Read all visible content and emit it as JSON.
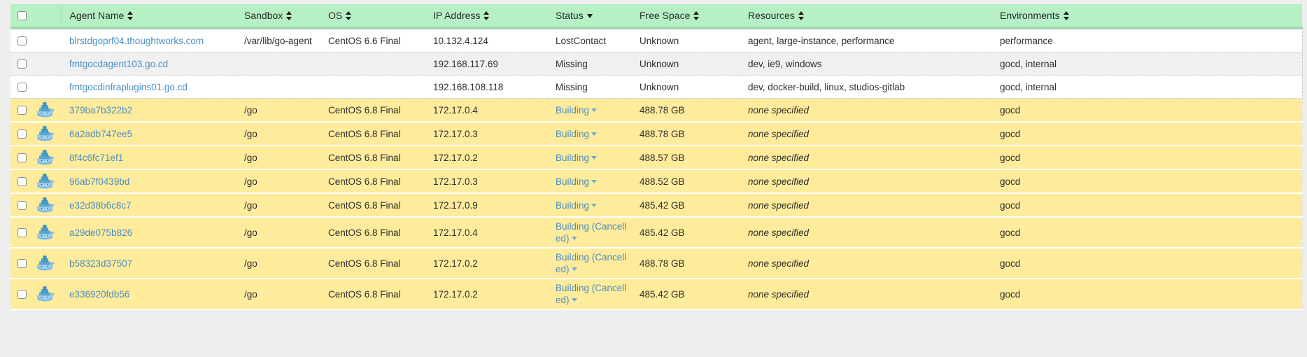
{
  "table": {
    "select_all_checkbox": false,
    "columns": [
      {
        "key": "checkbox",
        "label": "",
        "sort": "none"
      },
      {
        "key": "icon",
        "label": "",
        "sort": "none"
      },
      {
        "key": "agent_name",
        "label": "Agent Name",
        "sort": "both"
      },
      {
        "key": "sandbox",
        "label": "Sandbox",
        "sort": "both"
      },
      {
        "key": "os",
        "label": "OS",
        "sort": "both"
      },
      {
        "key": "ip_address",
        "label": "IP Address",
        "sort": "both"
      },
      {
        "key": "status",
        "label": "Status",
        "sort": "desc"
      },
      {
        "key": "free_space",
        "label": "Free Space",
        "sort": "both"
      },
      {
        "key": "resources",
        "label": "Resources",
        "sort": "both"
      },
      {
        "key": "environments",
        "label": "Environments",
        "sort": "both"
      }
    ],
    "rows": [
      {
        "checked": false,
        "icon": "",
        "agent_name": "blrstdgoprf04.thoughtworks.com",
        "sandbox": "/var/lib/go-agent",
        "os": "CentOS 6.6 Final",
        "ip_address": "10.132.4.124",
        "status": "LostContact",
        "status_link": false,
        "free_space": "Unknown",
        "resources": "agent, large-instance, performance",
        "resources_none": false,
        "environments": "performance",
        "style": "white"
      },
      {
        "checked": false,
        "icon": "",
        "agent_name": "fmtgocdagent103.go.cd",
        "sandbox": "",
        "os": "",
        "ip_address": "192.168.117.69",
        "status": "Missing",
        "status_link": false,
        "free_space": "Unknown",
        "resources": "dev, ie9, windows",
        "resources_none": false,
        "environments": "gocd, internal",
        "style": "grey"
      },
      {
        "checked": false,
        "icon": "",
        "agent_name": "fmtgocdinfraplugins01.go.cd",
        "sandbox": "",
        "os": "",
        "ip_address": "192.168.108.118",
        "status": "Missing",
        "status_link": false,
        "free_space": "Unknown",
        "resources": "dev, docker-build, linux, studios-gitlab",
        "resources_none": false,
        "environments": "gocd, internal",
        "style": "white"
      },
      {
        "checked": false,
        "icon": "docker-icon",
        "agent_name": "379ba7b322b2",
        "sandbox": "/go",
        "os": "CentOS 6.8 Final",
        "ip_address": "172.17.0.4",
        "status": "Building",
        "status_link": true,
        "free_space": "488.78 GB",
        "resources": "none specified",
        "resources_none": true,
        "environments": "gocd",
        "style": "building"
      },
      {
        "checked": false,
        "icon": "docker-icon",
        "agent_name": "6a2adb747ee5",
        "sandbox": "/go",
        "os": "CentOS 6.8 Final",
        "ip_address": "172.17.0.3",
        "status": "Building",
        "status_link": true,
        "free_space": "488.78 GB",
        "resources": "none specified",
        "resources_none": true,
        "environments": "gocd",
        "style": "building"
      },
      {
        "checked": false,
        "icon": "docker-icon",
        "agent_name": "8f4c6fc71ef1",
        "sandbox": "/go",
        "os": "CentOS 6.8 Final",
        "ip_address": "172.17.0.2",
        "status": "Building",
        "status_link": true,
        "free_space": "488.57 GB",
        "resources": "none specified",
        "resources_none": true,
        "environments": "gocd",
        "style": "building"
      },
      {
        "checked": false,
        "icon": "docker-icon",
        "agent_name": "96ab7f0439bd",
        "sandbox": "/go",
        "os": "CentOS 6.8 Final",
        "ip_address": "172.17.0.3",
        "status": "Building",
        "status_link": true,
        "free_space": "488.52 GB",
        "resources": "none specified",
        "resources_none": true,
        "environments": "gocd",
        "style": "building"
      },
      {
        "checked": false,
        "icon": "docker-icon",
        "agent_name": "e32d38b6c8c7",
        "sandbox": "/go",
        "os": "CentOS 6.8 Final",
        "ip_address": "172.17.0.9",
        "status": "Building",
        "status_link": true,
        "free_space": "485.42 GB",
        "resources": "none specified",
        "resources_none": true,
        "environments": "gocd",
        "style": "building"
      },
      {
        "checked": false,
        "icon": "docker-icon",
        "agent_name": "a29de075b826",
        "sandbox": "/go",
        "os": "CentOS 6.8 Final",
        "ip_address": "172.17.0.4",
        "status": "Building (Cancelled)",
        "status_link": true,
        "free_space": "485.42 GB",
        "resources": "none specified",
        "resources_none": true,
        "environments": "gocd",
        "style": "building"
      },
      {
        "checked": false,
        "icon": "docker-icon",
        "agent_name": "b58323d37507",
        "sandbox": "/go",
        "os": "CentOS 6.8 Final",
        "ip_address": "172.17.0.2",
        "status": "Building (Cancelled)",
        "status_link": true,
        "free_space": "488.78 GB",
        "resources": "none specified",
        "resources_none": true,
        "environments": "gocd",
        "style": "building"
      },
      {
        "checked": false,
        "icon": "docker-icon",
        "agent_name": "e336920fdb56",
        "sandbox": "/go",
        "os": "CentOS 6.8 Final",
        "ip_address": "172.17.0.2",
        "status": "Building (Cancelled)",
        "status_link": true,
        "free_space": "485.42 GB",
        "resources": "none specified",
        "resources_none": true,
        "environments": "gocd",
        "style": "building"
      }
    ]
  },
  "colors": {
    "header_bg": "#b6f0c5",
    "header_border": "#9ed8ad",
    "building_row_bg": "#ffeb9c",
    "link": "#4a90c4",
    "page_bg": "#eeeeee",
    "row_alt_bg": "#f0f0f0"
  }
}
